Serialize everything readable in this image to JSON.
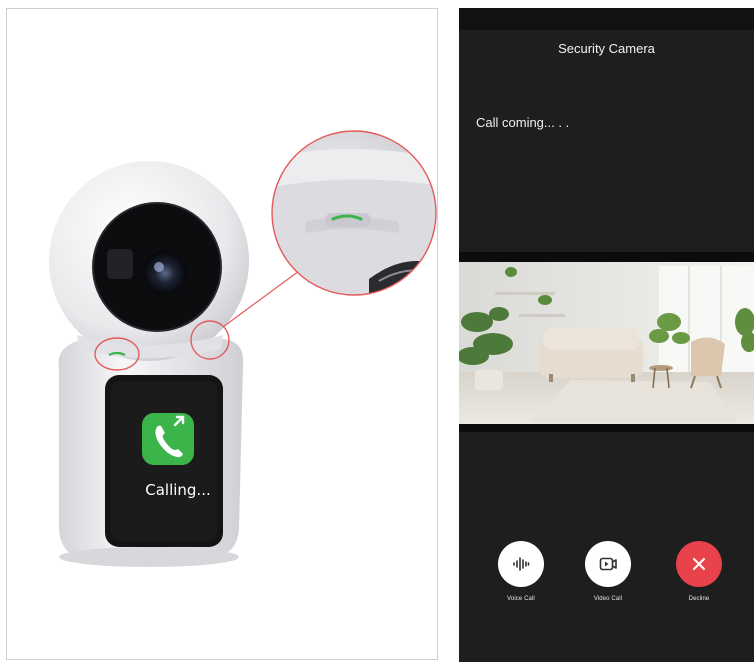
{
  "product": {
    "screen_text": "Calling..."
  },
  "app": {
    "title": "Security Camera",
    "call_status": "Call coming... . ."
  },
  "actions": [
    {
      "label": "Voice Call",
      "icon": "voice-wave-icon"
    },
    {
      "label": "Video Call",
      "icon": "video-camera-icon"
    },
    {
      "label": "Decline",
      "icon": "close-icon"
    }
  ],
  "colors": {
    "phone_bg": "#1e1e1e",
    "call_green": "#3bb54a",
    "decline_red": "#e8424a"
  }
}
